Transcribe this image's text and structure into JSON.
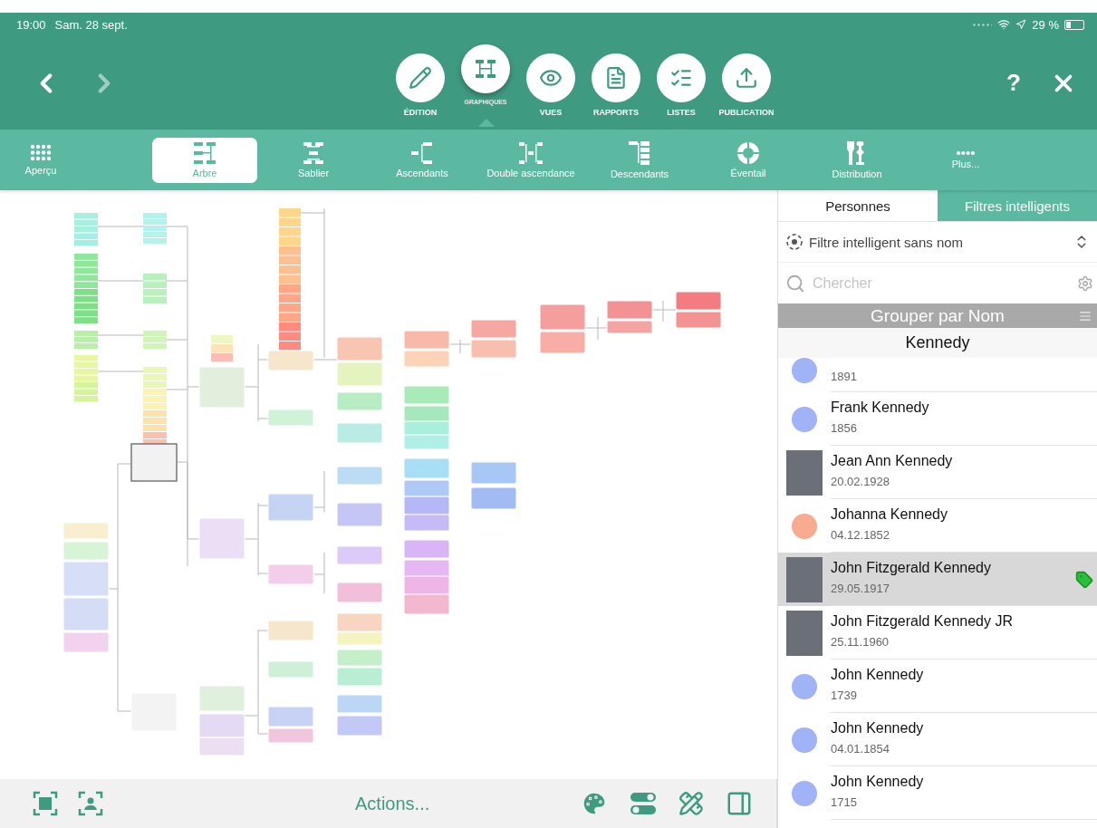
{
  "status_bar": {
    "time": "19:00",
    "date": "Sam. 28 sept.",
    "battery": "29 %"
  },
  "main_tabs": [
    {
      "label": "ÉDITION",
      "kind": "pencil",
      "selected": false
    },
    {
      "label": "GRAPHIQUES",
      "kind": "chart",
      "selected": true
    },
    {
      "label": "VUES",
      "kind": "eye",
      "selected": false
    },
    {
      "label": "RAPPORTS",
      "kind": "report",
      "selected": false
    },
    {
      "label": "LISTES",
      "kind": "list",
      "selected": false
    },
    {
      "label": "PUBLICATION",
      "kind": "upload",
      "selected": false
    }
  ],
  "help_label": "?",
  "chart_types": [
    {
      "label": "Aperçu",
      "kind": "grid",
      "selected": false
    },
    {
      "label": "Arbre",
      "kind": "tree",
      "selected": true
    },
    {
      "label": "Sablier",
      "kind": "hourglass",
      "selected": false
    },
    {
      "label": "Ascendants",
      "kind": "ancestors",
      "selected": false
    },
    {
      "label": "Double ascendance",
      "kind": "double",
      "selected": false
    },
    {
      "label": "Descendants",
      "kind": "descendants",
      "selected": false
    },
    {
      "label": "Éventail",
      "kind": "fan",
      "selected": false
    },
    {
      "label": "Distribution",
      "kind": "distribution",
      "selected": false
    },
    {
      "label": "Plus...",
      "kind": "more",
      "selected": false
    }
  ],
  "bottom_bar": {
    "actions": "Actions..."
  },
  "panel": {
    "tabs": [
      {
        "label": "Personnes",
        "selected": false
      },
      {
        "label": "Filtres intelligents",
        "selected": true
      }
    ],
    "filter": "Filtre intelligent sans nom",
    "search": {
      "placeholder": "Chercher"
    },
    "group_by": "Grouper par Nom",
    "section": "Kennedy",
    "persons": [
      {
        "date": "1891",
        "kind": "dot",
        "color": "#9fb3f6",
        "selected": false,
        "tagged": false
      },
      {
        "name": "Frank Kennedy",
        "date": "1856",
        "kind": "dot",
        "color": "#9fb3f6",
        "selected": false,
        "tagged": false
      },
      {
        "name": "Jean Ann Kennedy",
        "date": "20.02.1928",
        "kind": "photo",
        "selected": false,
        "tagged": false
      },
      {
        "name": "Johanna Kennedy",
        "date": "04.12.1852",
        "kind": "dot",
        "color": "#f8ab90",
        "selected": false,
        "tagged": false
      },
      {
        "name": "John Fitzgerald Kennedy",
        "date": "29.05.1917",
        "kind": "photo",
        "selected": true,
        "tagged": true
      },
      {
        "name": "John Fitzgerald Kennedy JR",
        "date": "25.11.1960",
        "kind": "photo",
        "selected": false,
        "tagged": false
      },
      {
        "name": "John Kennedy",
        "date": "1739",
        "kind": "dot",
        "color": "#9fb3f6",
        "selected": false,
        "tagged": false
      },
      {
        "name": "John Kennedy",
        "date": "04.01.1854",
        "kind": "dot",
        "color": "#9fb3f6",
        "selected": false,
        "tagged": false
      },
      {
        "name": "John Kennedy",
        "date": "1715",
        "kind": "dot",
        "color": "#9fb3f6",
        "selected": false,
        "tagged": false
      }
    ]
  }
}
